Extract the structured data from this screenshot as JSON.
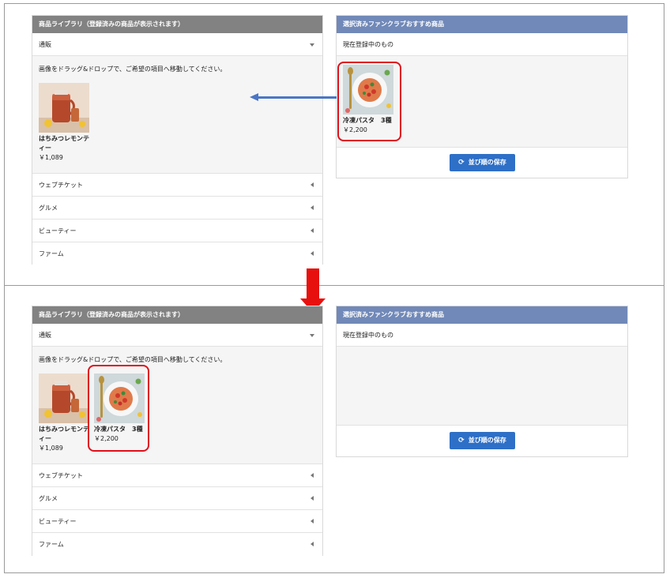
{
  "library": {
    "header": "商品ライブラリ（登録済みの商品が表示されます）",
    "open_category": "通販",
    "instruction": "画像をドラッグ&ドロップで、ご希望の項目へ移動してください。",
    "categories": [
      "ウェブチケット",
      "グルメ",
      "ビューティー",
      "ファーム"
    ]
  },
  "recommend": {
    "header": "選択済みファンクラブおすすめ商品",
    "subheader": "現在登録中のもの",
    "save_label": "並び順の保存"
  },
  "products": {
    "tea": {
      "name": "はちみつレモンティー",
      "price": "￥1,089"
    },
    "pasta": {
      "name": "冷凍パスタ　3種",
      "price": "￥2,200"
    }
  },
  "colors": {
    "library_header": "#828282",
    "recommend_header": "#7189b8",
    "save_button": "#2e6fc7",
    "highlight": "#e0101a",
    "blue_arrow": "#4a76c4",
    "red_arrow": "#e8100e"
  },
  "icons": {
    "accordion_open": "caret-down-icon",
    "accordion_closed": "caret-left-icon",
    "save": "refresh-icon"
  }
}
